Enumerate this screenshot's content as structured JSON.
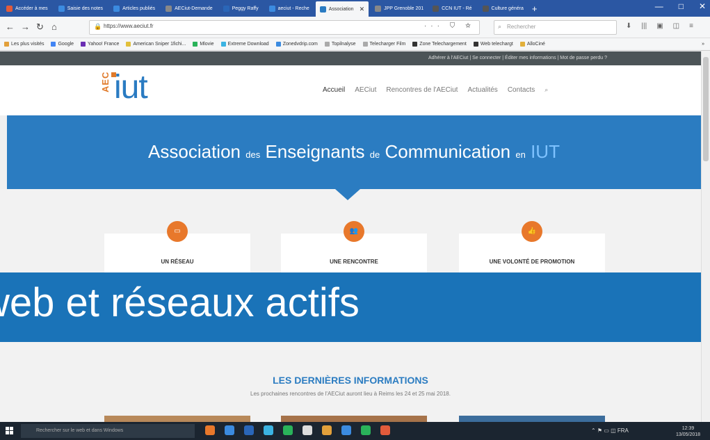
{
  "browser": {
    "tabs": [
      {
        "label": "Accéder à mes",
        "color": "#e25b3b"
      },
      {
        "label": "Saisie des notes",
        "color": "#3b8be0"
      },
      {
        "label": "Articles publiés",
        "color": "#3b8be0"
      },
      {
        "label": "AECiut-Demande",
        "color": "#888888"
      },
      {
        "label": "Peggy Raffy",
        "color": "#2a66b8"
      },
      {
        "label": "aeciut - Reche",
        "color": "#3b8be0"
      },
      {
        "label": "Association",
        "color": "#2a7bc2",
        "active": true
      },
      {
        "label": "JPP Grenoble 201",
        "color": "#888888"
      },
      {
        "label": "CCN IUT - Ré",
        "color": "#555555"
      },
      {
        "label": "Culture généra",
        "color": "#555555"
      }
    ],
    "new_tab": "+",
    "window_controls": [
      "—",
      "□",
      "✕"
    ],
    "url": "https://www.aeciut.fr",
    "url_actions": "··· ⛉ ☆",
    "search_placeholder": "Rechercher",
    "toolbar_icons": [
      "⬇",
      "|||",
      "▣",
      "◫",
      "≡"
    ],
    "bookmarks": [
      {
        "label": "Les plus visités",
        "color": "#e2a03b"
      },
      {
        "label": "Google",
        "color": "#4285f4"
      },
      {
        "label": "Yahoo! France",
        "color": "#6b2fb3"
      },
      {
        "label": "American Sniper 1fichi...",
        "color": "#e2c03b"
      },
      {
        "label": "Mlovie",
        "color": "#2ab35a"
      },
      {
        "label": "Extreme Download",
        "color": "#3bb3e2"
      },
      {
        "label": "Zonedvdrip.com",
        "color": "#3b8be0"
      },
      {
        "label": "Topilnalyse",
        "color": "#aaaaaa"
      },
      {
        "label": "Telecharger Film",
        "color": "#aaaaaa"
      },
      {
        "label": "Zone Telechargement",
        "color": "#333333"
      },
      {
        "label": "Web telechargt",
        "color": "#333333"
      },
      {
        "label": "AlloCiné",
        "color": "#e2b03b"
      }
    ],
    "bookmarks_more": "»"
  },
  "site": {
    "top_links": "Adhérer à l'AECiut  |  Se connecter  |  Éditer mes informations  |  Mot de passe perdu ?",
    "logo_small": "AEC",
    "logo_big": "iut",
    "nav": [
      "Accueil",
      "AECiut",
      "Rencontres de l'AECiut",
      "Actualités",
      "Contacts"
    ],
    "nav_search_icon": "⌕",
    "banner": {
      "w1": "Association",
      "s1": "des",
      "w2": "Enseignants",
      "s2": "de",
      "w3": "Communication",
      "s3": "en",
      "w4": "IUT"
    },
    "cards": [
      {
        "title": "UN RÉSEAU",
        "icon": "▭"
      },
      {
        "title": "UNE RENCONTRE",
        "icon": "👥"
      },
      {
        "title": "UNE VOLONTÉ DE PROMOTION",
        "icon": "👍"
      }
    ],
    "latest_title": "LES DERNIÈRES INFORMATIONS",
    "latest_sub": "Les prochaines rencontres de l'AECiut auront lieu à Reims les 24 et 25 mai 2018."
  },
  "caption": "web et réseaux actifs",
  "taskbar": {
    "search_placeholder": "Rechercher sur le web et dans Windows",
    "apps": [
      "#e8782b",
      "#3b8be0",
      "#2a66b8",
      "#3bb3e2",
      "#2ab35a",
      "#dddddd",
      "#e2a03b",
      "#3b8be0",
      "#2ab35a",
      "#e25b3b"
    ],
    "tray": "⌃ ⚑ ▭ ◫ FRA",
    "time": "12:39",
    "date": "13/05/2018"
  },
  "colors": {
    "brand_blue": "#2b7cc1",
    "brand_orange": "#e8782b",
    "caption_blue": "#1a73b8"
  }
}
